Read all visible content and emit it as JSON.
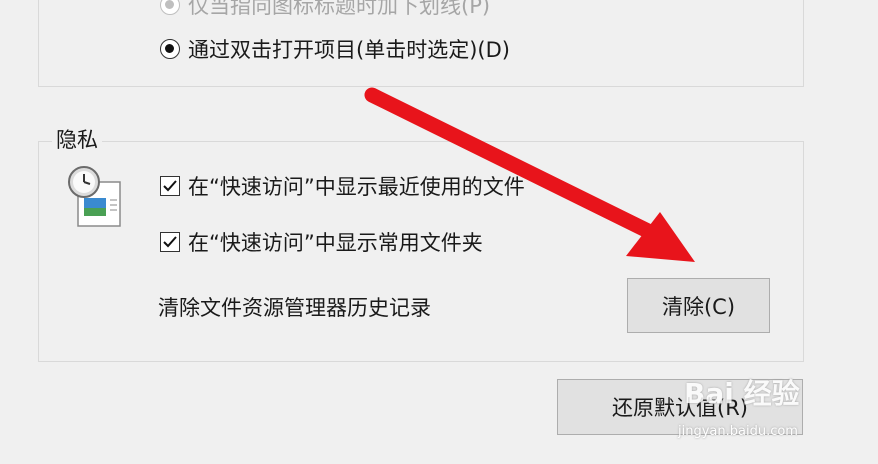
{
  "options": {
    "underline_label": "仅当指向图标标题时加下划线(P)",
    "double_click_label": "通过双击打开项目(单击时选定)(D)"
  },
  "privacy": {
    "legend": "隐私",
    "show_recent_files": "在“快速访问”中显示最近使用的文件",
    "show_frequent_folders": "在“快速访问”中显示常用文件夹",
    "clear_history_text": "清除文件资源管理器历史记录",
    "clear_button": "清除(C)"
  },
  "footer": {
    "restore_defaults_button": "还原默认值(R)"
  },
  "watermark": {
    "logo": "Bai 经验",
    "url": "jingyan.baidu.com"
  },
  "icons": {
    "privacy": "clock-document-icon",
    "annotation": "red-arrow"
  },
  "colors": {
    "arrow": "#e8141b",
    "button_bg": "#e1e1e1",
    "window_bg": "#f0f0f0"
  }
}
